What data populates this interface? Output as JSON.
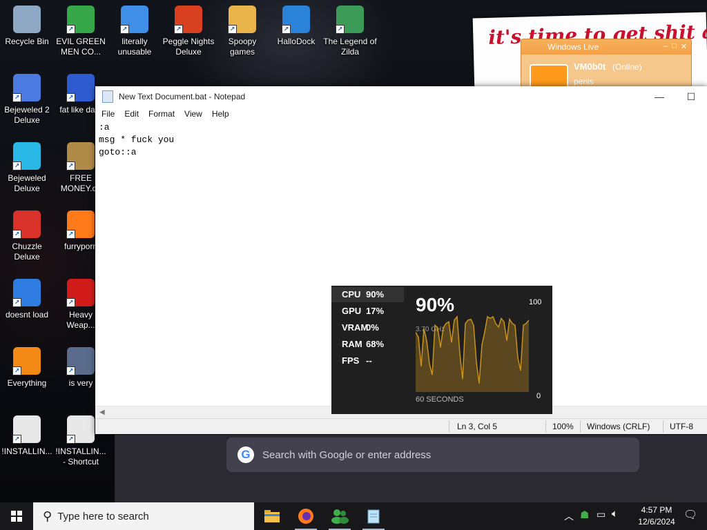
{
  "desktop": {
    "icons": [
      {
        "label": "Recycle Bin",
        "icon": "recycle-bin-icon",
        "color": "#8fa8c4"
      },
      {
        "label": "EVIL GREEN MEN CO...",
        "icon": "green-people-icon",
        "color": "#37a84a"
      },
      {
        "label": "literally unusable",
        "icon": "chrome-icon",
        "color": "#3f8ee8"
      },
      {
        "label": "Peggle Nights Deluxe",
        "icon": "peggle-icon",
        "color": "#d8401f"
      },
      {
        "label": "Spoopy games",
        "icon": "folder-icon",
        "color": "#e9b54a"
      },
      {
        "label": "HalloDock",
        "icon": "windows-logo-icon",
        "color": "#2a83d8"
      },
      {
        "label": "The Legend of Zilda",
        "icon": "zilda-icon",
        "color": "#3c9b57"
      },
      {
        "label": "Bejeweled 2 Deluxe",
        "icon": "bejeweled2-icon",
        "color": "#4b7be0"
      },
      {
        "label": "fat like dark",
        "icon": "mpl-logo-icon",
        "color": "#2f5bd0"
      },
      {
        "label": "Bejeweled Deluxe",
        "icon": "diamond-icon",
        "color": "#29b8e6"
      },
      {
        "label": "FREE MONEY.co",
        "icon": "money-bag-icon",
        "color": "#b08a47"
      },
      {
        "label": "Chuzzle Deluxe",
        "icon": "chuzzle-icon",
        "color": "#d8322a"
      },
      {
        "label": "furryporn",
        "icon": "firefox-icon",
        "color": "#ff7a18"
      },
      {
        "label": "doesnt load",
        "icon": "thunderbird-icon",
        "color": "#2f7de1"
      },
      {
        "label": "Heavy Weap...",
        "icon": "radiation-icon",
        "color": "#d21c1c"
      },
      {
        "label": "Everything",
        "icon": "everything-search-icon",
        "color": "#f28a15"
      },
      {
        "label": "is very",
        "icon": "mpl-shield-icon",
        "color": "#5a6b8c"
      },
      {
        "label": "!INSTALLIN...",
        "icon": "text-file-icon",
        "color": "#e8e8e8"
      },
      {
        "label": "!INSTALLIN... - Shortcut",
        "icon": "text-file-shortcut-icon",
        "color": "#e8e8e8"
      }
    ],
    "poster_text": "it's time to get shit and or t",
    "messenger": {
      "title": "Windows Live",
      "display_name": "VM0b0t",
      "status": "(Online)",
      "personal_message": "penis"
    }
  },
  "notepad": {
    "title": "New Text Document.bat - Notepad",
    "menu": [
      "File",
      "Edit",
      "Format",
      "View",
      "Help"
    ],
    "content": ":a\nmsg * fuck you\ngoto::a",
    "status": {
      "position": "Ln 3, Col 5",
      "zoom": "100%",
      "line_ending": "Windows (CRLF)",
      "encoding": "UTF-8"
    }
  },
  "perf_widget": {
    "rows": [
      {
        "label": "CPU",
        "value": "90%"
      },
      {
        "label": "GPU",
        "value": "17%"
      },
      {
        "label": "VRAM",
        "value": "0%"
      },
      {
        "label": "RAM",
        "value": "68%"
      },
      {
        "label": "FPS",
        "value": "--"
      }
    ],
    "big_value": "90%",
    "max_label": "100",
    "min_label": "0",
    "clock_speed": "3.70 GHz",
    "window_label": "60 SECONDS",
    "accent_color": "#c8921f",
    "series": [
      70,
      64,
      30,
      74,
      60,
      33,
      20,
      78,
      75,
      52,
      75,
      80,
      82,
      58,
      84,
      88,
      45,
      15,
      80,
      84,
      85,
      78,
      35,
      10,
      55,
      70,
      88,
      86,
      88,
      80,
      76,
      86,
      82,
      60,
      85,
      80,
      78,
      40,
      25,
      78,
      80,
      84
    ]
  },
  "browser": {
    "search_placeholder": "Search with Google or enter address",
    "g_letter": "G"
  },
  "taskbar": {
    "search_placeholder": "Type here to search",
    "apps": [
      "file-explorer-icon",
      "firefox-icon",
      "messenger-people-icon",
      "notepad-icon"
    ],
    "time": "4:57 PM",
    "date": "12/6/2024"
  }
}
